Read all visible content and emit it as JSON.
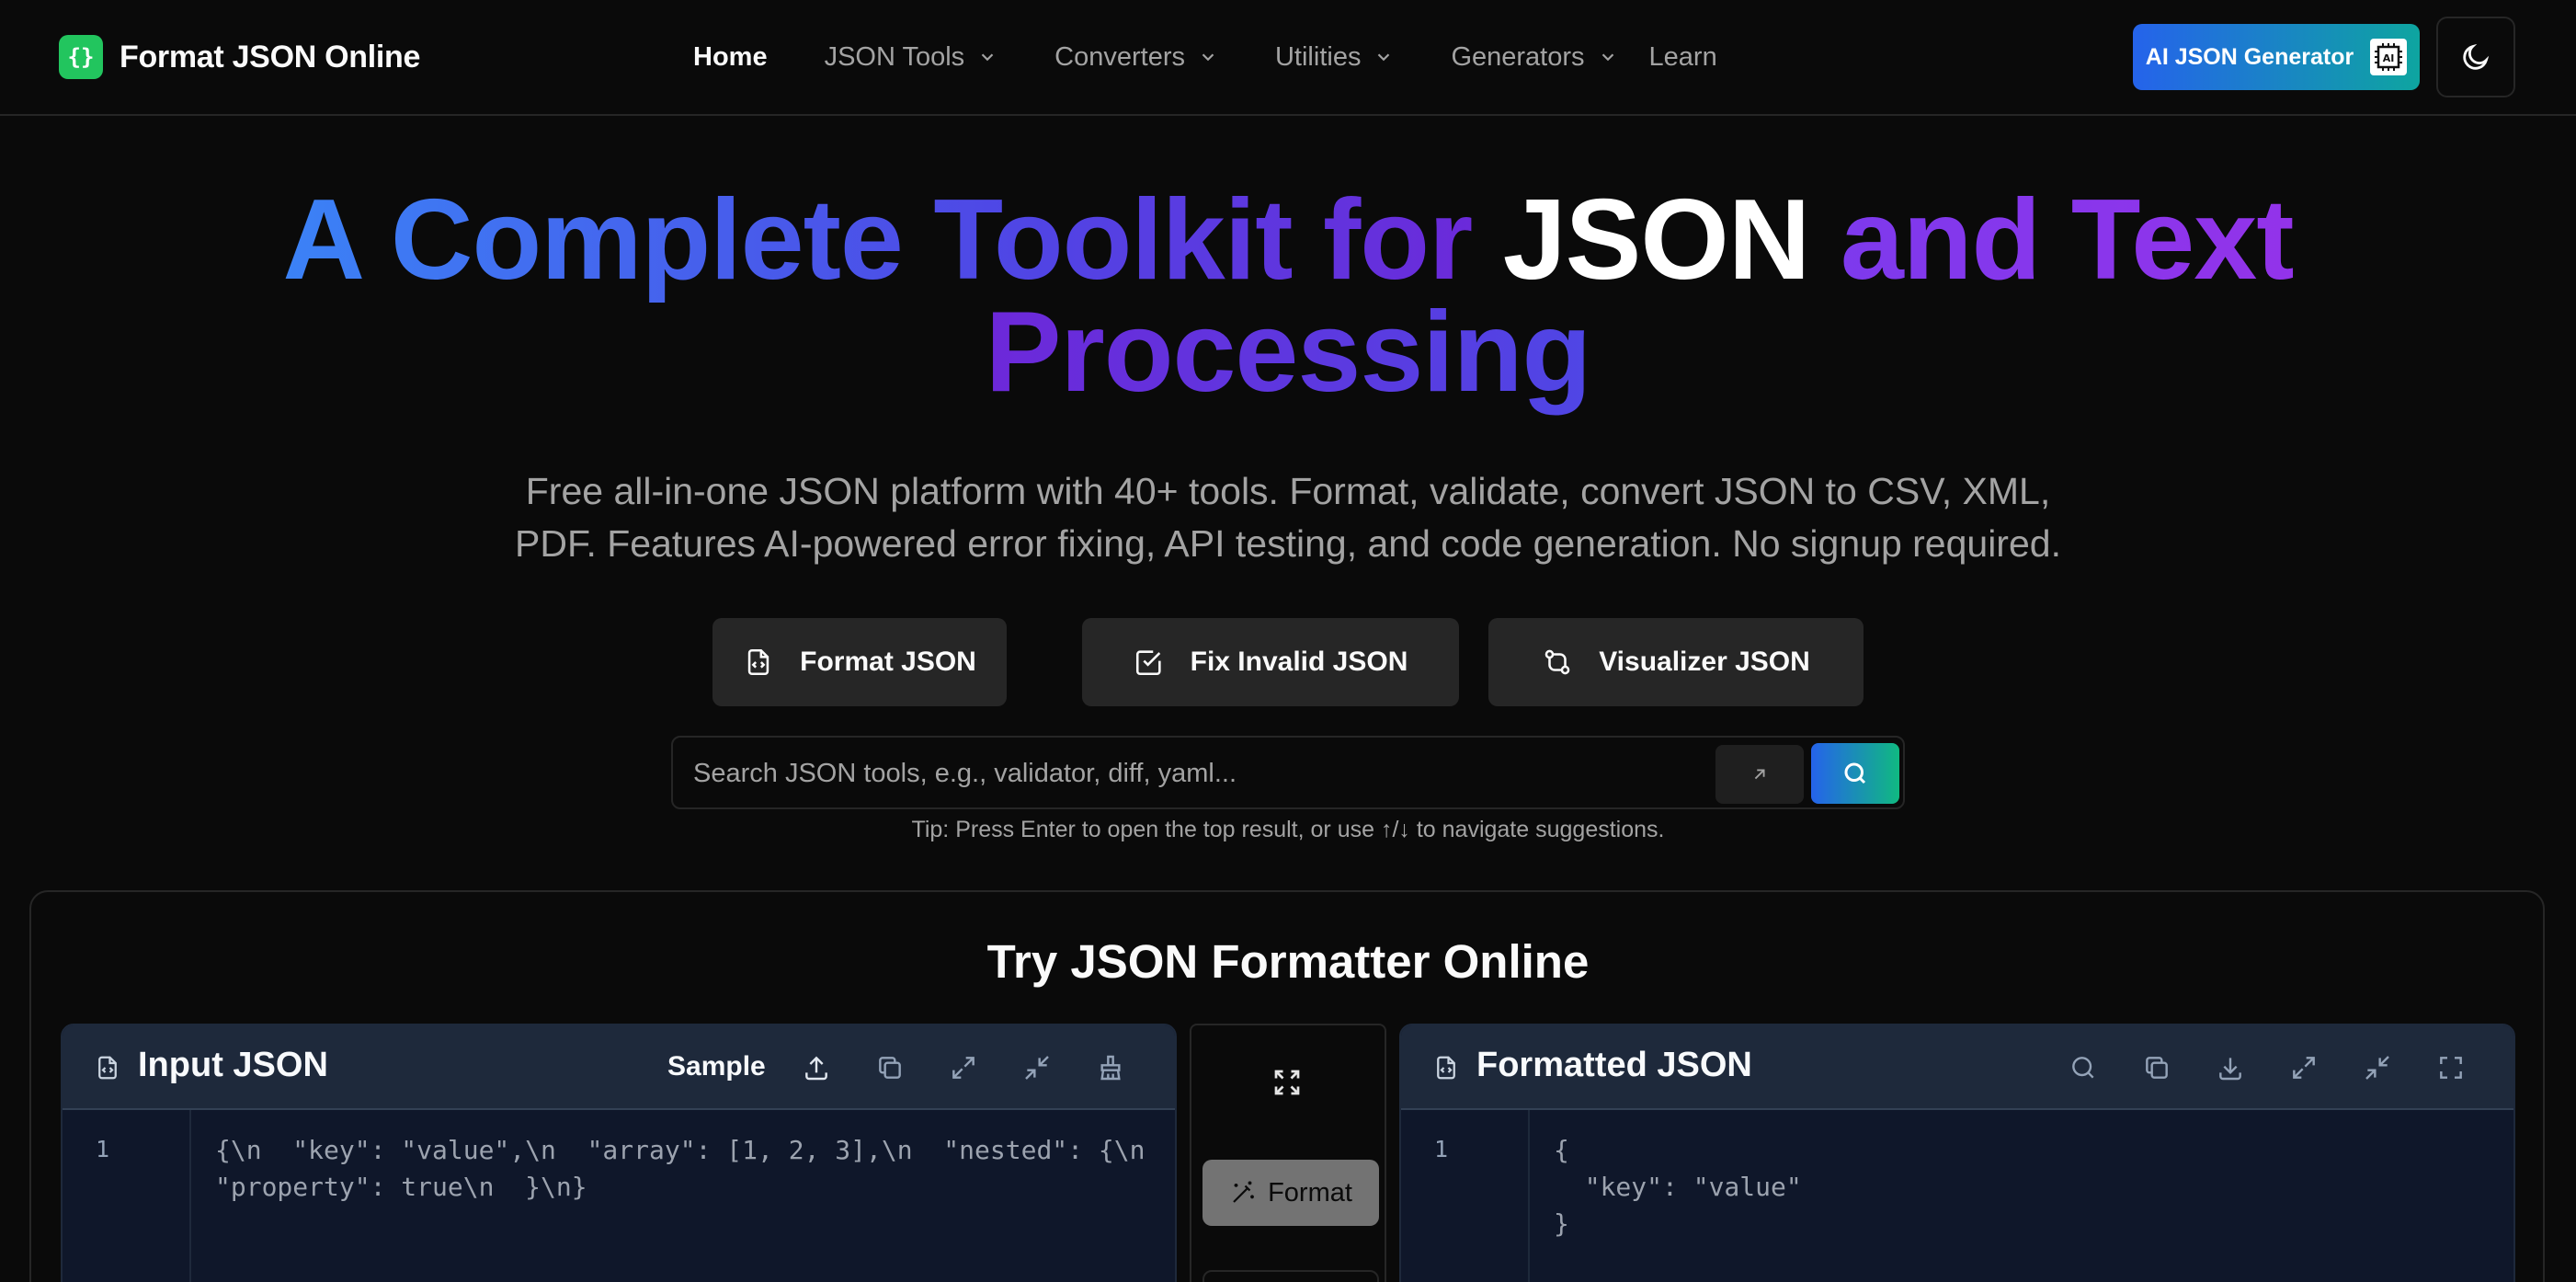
{
  "brand": {
    "logo_glyph": "{}",
    "name": "Format JSON Online",
    "logo_color": "#22c55e"
  },
  "nav": {
    "items": [
      {
        "label": "Home",
        "has_dropdown": false,
        "active": true
      },
      {
        "label": "JSON Tools",
        "has_dropdown": true
      },
      {
        "label": "Converters",
        "has_dropdown": true
      },
      {
        "label": "Utilities",
        "has_dropdown": true
      },
      {
        "label": "Generators",
        "has_dropdown": true
      },
      {
        "label": "Learn",
        "has_dropdown": false
      }
    ],
    "ai_button_label": "AI JSON Generator",
    "ai_chip_glyph": "AI",
    "theme_toggle_icon": "moon-icon"
  },
  "hero": {
    "title_part1": "A Complete Toolkit for ",
    "title_part2": "JSON",
    "title_part3": " and Text",
    "title_part4": "Processing",
    "subtitle_line1": "Free all-in-one JSON platform with 40+ tools. Format, validate, convert JSON to CSV, XML,",
    "subtitle_line2": "PDF. Features AI-powered error fixing, API testing, and code generation. No signup required.",
    "cta": [
      {
        "label": "Format JSON",
        "icon": "file-code-icon"
      },
      {
        "label": "Fix Invalid JSON",
        "icon": "check-square-icon"
      },
      {
        "label": "Visualizer JSON",
        "icon": "git-compare-icon"
      }
    ]
  },
  "search": {
    "placeholder": "Search JSON tools, e.g., validator, diff, yaml...",
    "value": "",
    "tip": "Tip: Press Enter to open the top result, or use ↑/↓ to navigate suggestions."
  },
  "try_section": {
    "title": "Try JSON Formatter Online",
    "input_panel": {
      "title": "Input JSON",
      "sample_label": "Sample",
      "line_number": "1",
      "code_lines": [
        "{\\n  \"key\": \"value\",\\n  \"array\": [1, 2, 3],\\n  \"nested\": {\\n",
        "\"property\": true\\n  }\\n}"
      ]
    },
    "format_button_label": "Format",
    "output_panel": {
      "title": "Formatted JSON",
      "line_number": "1",
      "code_lines": [
        "{",
        "  \"key\": \"value\"",
        "}"
      ]
    }
  }
}
